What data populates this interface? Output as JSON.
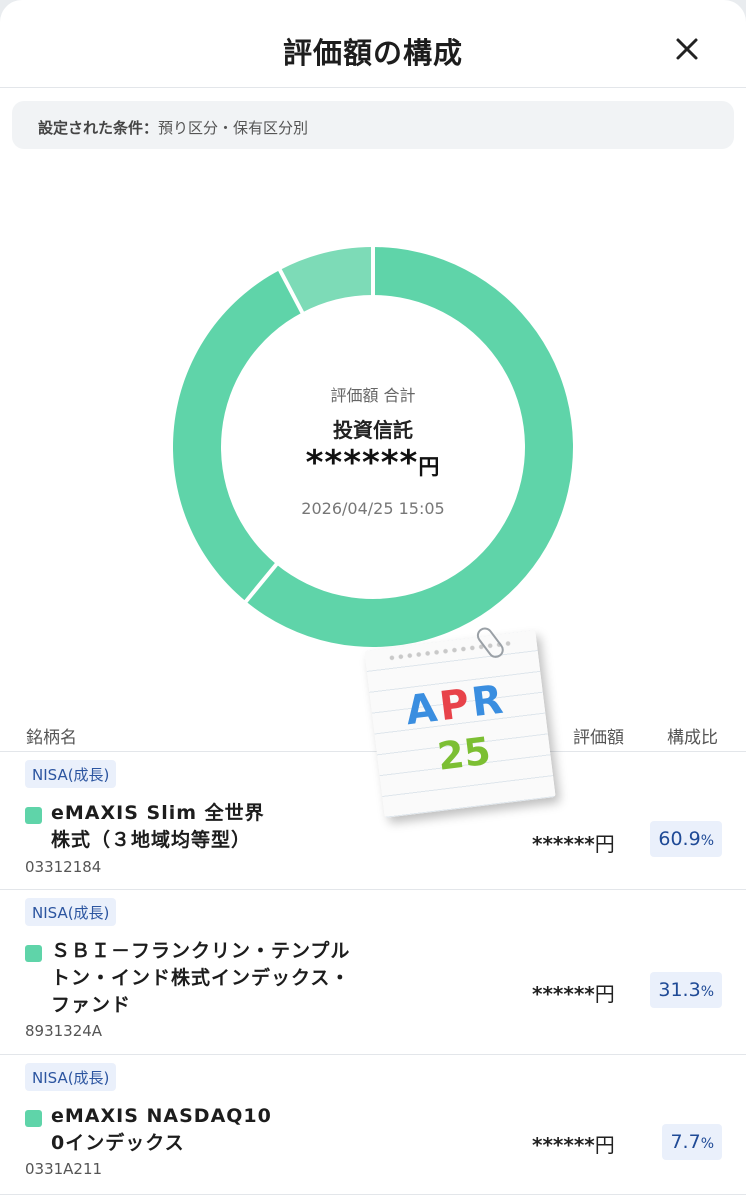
{
  "header": {
    "title": "評価額の構成",
    "close_icon": "close-icon"
  },
  "condition": {
    "label": "設定された条件：",
    "value": "預り区分・保有区分別"
  },
  "summary": {
    "label": "評価額 合計",
    "type": "投資信託",
    "value": "******",
    "unit": "円",
    "timestamp": "2026/04/25 15:05"
  },
  "chart_data": {
    "type": "pie",
    "donut": true,
    "categories": [
      "eMAXIS Slim 全世界株式（３地域均等型）",
      "ＳＢＩ－フランクリン・テンプルトン・インド株式インデックス・ファンド",
      "eMAXIS NASDAQ100インデックス"
    ],
    "values": [
      60.9,
      31.3,
      7.7
    ],
    "colors": [
      "#5fd4a9",
      "#5fd4a9",
      "#7ddbb7"
    ],
    "separator_color": "#ffffff"
  },
  "sticker": {
    "line1": "APR",
    "line2": "25"
  },
  "table": {
    "headers": {
      "name": "銘柄名",
      "value": "評価額",
      "ratio": "構成比"
    },
    "rows": [
      {
        "badge": "NISA(成長)",
        "name_line1": "eMAXIS Slim 全世界",
        "name_line2": "株式（３地域均等型）",
        "name_line3": "",
        "code": "03312184",
        "value": "******",
        "unit": "円",
        "ratio": "60.9",
        "pct": "%",
        "color": "#5fd4a9"
      },
      {
        "badge": "NISA(成長)",
        "name_line1": "ＳＢＩ－フランクリン・テンプル",
        "name_line2": "トン・インド株式インデックス・",
        "name_line3": "ファンド",
        "code": "8931324A",
        "value": "******",
        "unit": "円",
        "ratio": "31.3",
        "pct": "%",
        "color": "#5fd4a9"
      },
      {
        "badge": "NISA(成長)",
        "name_line1": "eMAXIS NASDAQ10",
        "name_line2": "0インデックス",
        "name_line3": "",
        "code": "0331A211",
        "value": "******",
        "unit": "円",
        "ratio": "7.7",
        "pct": "%",
        "color": "#5fd4a9"
      }
    ]
  }
}
